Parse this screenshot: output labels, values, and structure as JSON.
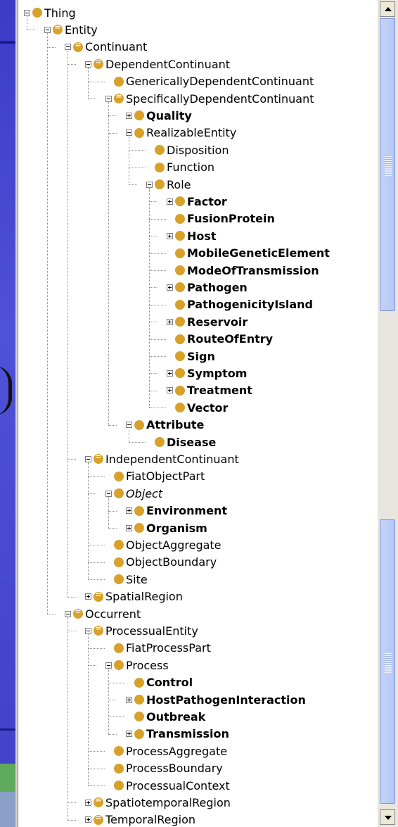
{
  "tree": {
    "nodes": [
      {
        "label": "Thing",
        "depth": 0,
        "toggle": "minus",
        "bold": false,
        "italic": false,
        "eq": false
      },
      {
        "label": "Entity",
        "depth": 1,
        "toggle": "minus",
        "bold": false,
        "italic": false,
        "eq": true
      },
      {
        "label": "Continuant",
        "depth": 2,
        "toggle": "minus",
        "bold": false,
        "italic": false,
        "eq": true
      },
      {
        "label": "DependentContinuant",
        "depth": 3,
        "toggle": "minus",
        "bold": false,
        "italic": false,
        "eq": true
      },
      {
        "label": "GenericallyDependentContinuant",
        "depth": 4,
        "toggle": "none",
        "bold": false,
        "italic": false,
        "eq": false
      },
      {
        "label": "SpecificallyDependentContinuant",
        "depth": 4,
        "toggle": "minus",
        "bold": false,
        "italic": false,
        "eq": true
      },
      {
        "label": "Quality",
        "depth": 5,
        "toggle": "plus",
        "bold": true,
        "italic": false,
        "eq": false
      },
      {
        "label": "RealizableEntity",
        "depth": 5,
        "toggle": "minus",
        "bold": false,
        "italic": false,
        "eq": false
      },
      {
        "label": "Disposition",
        "depth": 6,
        "toggle": "none",
        "bold": false,
        "italic": false,
        "eq": false
      },
      {
        "label": "Function",
        "depth": 6,
        "toggle": "none",
        "bold": false,
        "italic": false,
        "eq": false
      },
      {
        "label": "Role",
        "depth": 6,
        "toggle": "minus",
        "bold": false,
        "italic": false,
        "eq": false
      },
      {
        "label": "Factor",
        "depth": 7,
        "toggle": "plus",
        "bold": true,
        "italic": false,
        "eq": false
      },
      {
        "label": "FusionProtein",
        "depth": 7,
        "toggle": "none",
        "bold": true,
        "italic": false,
        "eq": false
      },
      {
        "label": "Host",
        "depth": 7,
        "toggle": "plus",
        "bold": true,
        "italic": false,
        "eq": false
      },
      {
        "label": "MobileGeneticElement",
        "depth": 7,
        "toggle": "none",
        "bold": true,
        "italic": false,
        "eq": false
      },
      {
        "label": "ModeOfTransmission",
        "depth": 7,
        "toggle": "none",
        "bold": true,
        "italic": false,
        "eq": false
      },
      {
        "label": "Pathogen",
        "depth": 7,
        "toggle": "plus",
        "bold": true,
        "italic": false,
        "eq": false
      },
      {
        "label": "PathogenicityIsland",
        "depth": 7,
        "toggle": "none",
        "bold": true,
        "italic": false,
        "eq": false
      },
      {
        "label": "Reservoir",
        "depth": 7,
        "toggle": "plus",
        "bold": true,
        "italic": false,
        "eq": false
      },
      {
        "label": "RouteOfEntry",
        "depth": 7,
        "toggle": "none",
        "bold": true,
        "italic": false,
        "eq": false
      },
      {
        "label": "Sign",
        "depth": 7,
        "toggle": "none",
        "bold": true,
        "italic": false,
        "eq": false
      },
      {
        "label": "Symptom",
        "depth": 7,
        "toggle": "plus",
        "bold": true,
        "italic": false,
        "eq": false
      },
      {
        "label": "Treatment",
        "depth": 7,
        "toggle": "plus",
        "bold": true,
        "italic": false,
        "eq": false
      },
      {
        "label": "Vector",
        "depth": 7,
        "toggle": "none",
        "bold": true,
        "italic": false,
        "eq": false
      },
      {
        "label": "Attribute",
        "depth": 5,
        "toggle": "minus",
        "bold": true,
        "italic": false,
        "eq": false
      },
      {
        "label": "Disease",
        "depth": 6,
        "toggle": "none",
        "bold": true,
        "italic": false,
        "eq": false
      },
      {
        "label": "IndependentContinuant",
        "depth": 3,
        "toggle": "minus",
        "bold": false,
        "italic": false,
        "eq": true
      },
      {
        "label": "FiatObjectPart",
        "depth": 4,
        "toggle": "none",
        "bold": false,
        "italic": false,
        "eq": false
      },
      {
        "label": "Object",
        "depth": 4,
        "toggle": "minus",
        "bold": false,
        "italic": true,
        "eq": false
      },
      {
        "label": "Environment",
        "depth": 5,
        "toggle": "plus",
        "bold": true,
        "italic": false,
        "eq": false
      },
      {
        "label": "Organism",
        "depth": 5,
        "toggle": "plus",
        "bold": true,
        "italic": false,
        "eq": false
      },
      {
        "label": "ObjectAggregate",
        "depth": 4,
        "toggle": "none",
        "bold": false,
        "italic": false,
        "eq": false
      },
      {
        "label": "ObjectBoundary",
        "depth": 4,
        "toggle": "none",
        "bold": false,
        "italic": false,
        "eq": false
      },
      {
        "label": "Site",
        "depth": 4,
        "toggle": "none",
        "bold": false,
        "italic": false,
        "eq": false
      },
      {
        "label": "SpatialRegion",
        "depth": 3,
        "toggle": "plus",
        "bold": false,
        "italic": false,
        "eq": true
      },
      {
        "label": "Occurrent",
        "depth": 2,
        "toggle": "minus",
        "bold": false,
        "italic": false,
        "eq": true
      },
      {
        "label": "ProcessualEntity",
        "depth": 3,
        "toggle": "minus",
        "bold": false,
        "italic": false,
        "eq": true
      },
      {
        "label": "FiatProcessPart",
        "depth": 4,
        "toggle": "none",
        "bold": false,
        "italic": false,
        "eq": false
      },
      {
        "label": "Process",
        "depth": 4,
        "toggle": "minus",
        "bold": false,
        "italic": false,
        "eq": false
      },
      {
        "label": "Control",
        "depth": 5,
        "toggle": "none",
        "bold": true,
        "italic": false,
        "eq": false
      },
      {
        "label": "HostPathogenInteraction",
        "depth": 5,
        "toggle": "plus",
        "bold": true,
        "italic": false,
        "eq": false
      },
      {
        "label": "Outbreak",
        "depth": 5,
        "toggle": "none",
        "bold": true,
        "italic": false,
        "eq": false
      },
      {
        "label": "Transmission",
        "depth": 5,
        "toggle": "plus",
        "bold": true,
        "italic": false,
        "eq": false
      },
      {
        "label": "ProcessAggregate",
        "depth": 4,
        "toggle": "none",
        "bold": false,
        "italic": false,
        "eq": false
      },
      {
        "label": "ProcessBoundary",
        "depth": 4,
        "toggle": "none",
        "bold": false,
        "italic": false,
        "eq": false
      },
      {
        "label": "ProcessualContext",
        "depth": 4,
        "toggle": "none",
        "bold": false,
        "italic": false,
        "eq": false
      },
      {
        "label": "SpatiotemporalRegion",
        "depth": 3,
        "toggle": "plus",
        "bold": false,
        "italic": false,
        "eq": true
      },
      {
        "label": "TemporalRegion",
        "depth": 3,
        "toggle": "plus",
        "bold": false,
        "italic": false,
        "eq": true
      }
    ]
  },
  "colors": {
    "node_dot": "#d7a12a",
    "slide_blue": "#3f41c9"
  }
}
